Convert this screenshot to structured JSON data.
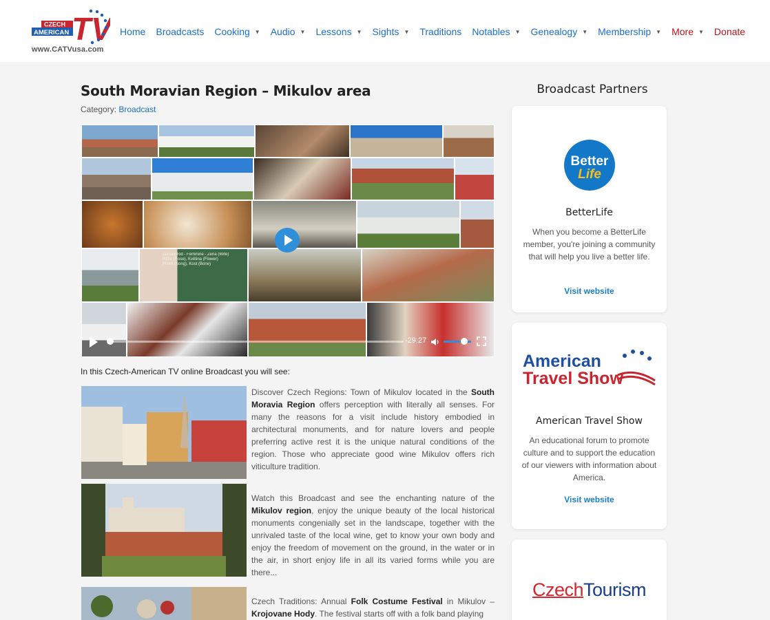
{
  "header": {
    "logo_top": "CZECH",
    "logo_mid": "AMERICAN",
    "logo_tv": "TV",
    "logo_url": "www.CATVusa.com",
    "nav": [
      {
        "label": "Home",
        "dropdown": false
      },
      {
        "label": "Broadcasts",
        "dropdown": false
      },
      {
        "label": "Cooking",
        "dropdown": true
      },
      {
        "label": "Audio",
        "dropdown": true
      },
      {
        "label": "Lessons",
        "dropdown": true
      },
      {
        "label": "Sights",
        "dropdown": true
      },
      {
        "label": "Traditions",
        "dropdown": false
      },
      {
        "label": "Notables",
        "dropdown": true
      },
      {
        "label": "Genealogy",
        "dropdown": true
      },
      {
        "label": "Membership",
        "dropdown": true
      },
      {
        "label": "More",
        "dropdown": true
      },
      {
        "label": "Donate",
        "dropdown": false
      }
    ]
  },
  "main": {
    "title": "South Moravian Region – Mikulov area",
    "category_prefix": "Category: ",
    "category_link": "Broadcast",
    "video": {
      "time": "-29:27",
      "progress": 0.01,
      "volume": 0.7,
      "chalkboard_text": "Ženský rod - Feminine - Žena (Wife)\nRůže (Rose), Květina (Flower)\nPíseň (Song), Kost (Bone)"
    },
    "intro": "In this Czech-American TV online Broadcast you will see:",
    "para1": {
      "t1": "Discover Czech Regions: Town of Mikulov located in the ",
      "b1": "South Moravia Region",
      "t2": " offers perception with literally all senses. For many the reasons for a visit include history embodied in architectural monuments, and for nature lovers and people preferring active rest it is the unique natural conditions of the region. Those who appreciate good wine Mikulov offers rich viticulture tradition."
    },
    "para2": {
      "t1": "Watch this Broadcast and see the enchanting nature of the ",
      "b1": "Mikulov region",
      "t2": ", enjoy the unique beauty of the local historical monuments congenially set in the landscape, together with the unrivaled taste of the local wine, get to know your own body and enjoy the freedom of movement on the ground, in the water or in the air, in short enjoy life in all its varied forms while you are there..."
    },
    "para3": {
      "t1": "Czech Traditions:   Annual ",
      "b1": "Folk Costume Festival",
      "t2": " in Mikulov – ",
      "b2": "Krojovane Hody",
      "t3": ". The festival starts off with a folk band playing"
    }
  },
  "sidebar": {
    "title": "Broadcast Partners",
    "cards": [
      {
        "logo_line1": "Better",
        "logo_line2": "Life",
        "name": "BetterLife",
        "desc": "When you become a BetterLife member, you're joining a community that will help you live a better life.",
        "link": "Visit website"
      },
      {
        "logo_line1": "American",
        "logo_line2": "Travel Show",
        "name": "American Travel Show",
        "desc": "An educational forum to promote culture and to support the education of our viewers with information about America.",
        "link": "Visit website"
      },
      {
        "logo_part1": "Czech",
        "logo_part2": "Tourism"
      }
    ]
  },
  "colors": {
    "link_blue": "#1a6fc9",
    "nav_red": "#b3151b",
    "play_blue": "#2f8fd8"
  }
}
